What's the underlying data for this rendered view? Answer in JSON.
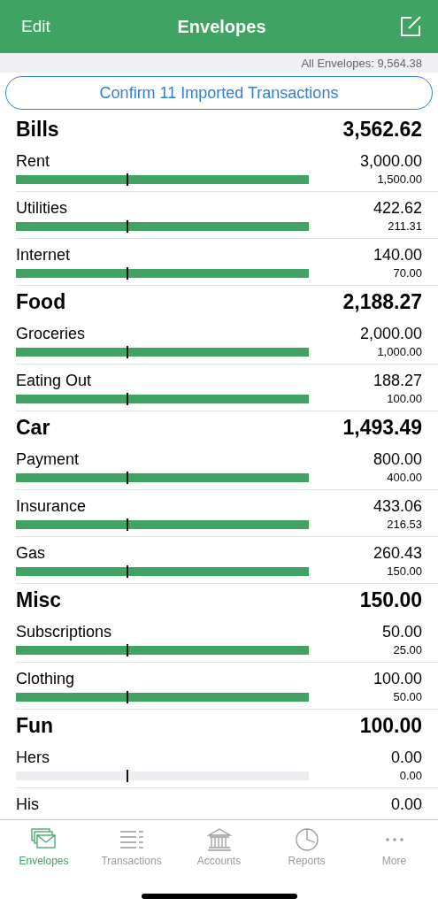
{
  "nav_bar": {
    "left_button": "Edit",
    "title": "Envelopes"
  },
  "summary": "All Envelopes: 9,564.38",
  "confirm_button": "Confirm 11 Imported Transactions",
  "groups": [
    {
      "name": "Bills",
      "total": "3,562.62",
      "envelopes": [
        {
          "name": "Rent",
          "amount": "3,000.00",
          "budget": "1,500.00",
          "level": 1
        },
        {
          "name": "Utilities",
          "amount": "422.62",
          "budget": "211.31",
          "level": 1
        },
        {
          "name": "Internet",
          "amount": "140.00",
          "budget": "70.00",
          "level": 1
        }
      ]
    },
    {
      "name": "Food",
      "total": "2,188.27",
      "envelopes": [
        {
          "name": "Groceries",
          "amount": "2,000.00",
          "budget": "1,000.00",
          "level": 1
        },
        {
          "name": "Eating Out",
          "amount": "188.27",
          "budget": "100.00",
          "level": 1
        }
      ]
    },
    {
      "name": "Car",
      "total": "1,493.49",
      "envelopes": [
        {
          "name": "Payment",
          "amount": "800.00",
          "budget": "400.00",
          "level": 1
        },
        {
          "name": "Insurance",
          "amount": "433.06",
          "budget": "216.53",
          "level": 1
        },
        {
          "name": "Gas",
          "amount": "260.43",
          "budget": "150.00",
          "level": 1
        }
      ]
    },
    {
      "name": "Misc",
      "total": "150.00",
      "envelopes": [
        {
          "name": "Subscriptions",
          "amount": "50.00",
          "budget": "25.00",
          "level": 1
        },
        {
          "name": "Clothing",
          "amount": "100.00",
          "budget": "50.00",
          "level": 1
        }
      ]
    },
    {
      "name": "Fun",
      "total": "100.00",
      "envelopes": [
        {
          "name": "Hers",
          "amount": "0.00",
          "budget": "0.00",
          "level": 0
        },
        {
          "name": "His",
          "amount": "0.00"
        }
      ]
    }
  ],
  "tab_bar": [
    {
      "kind": "envelopes",
      "label": "Envelopes",
      "selected": true
    },
    {
      "kind": "transactions",
      "label": "Transactions",
      "selected": false
    },
    {
      "kind": "accounts",
      "label": "Accounts",
      "selected": false
    },
    {
      "kind": "reports",
      "label": "Reports",
      "selected": false
    },
    {
      "kind": "more",
      "label": "More",
      "selected": false
    }
  ]
}
